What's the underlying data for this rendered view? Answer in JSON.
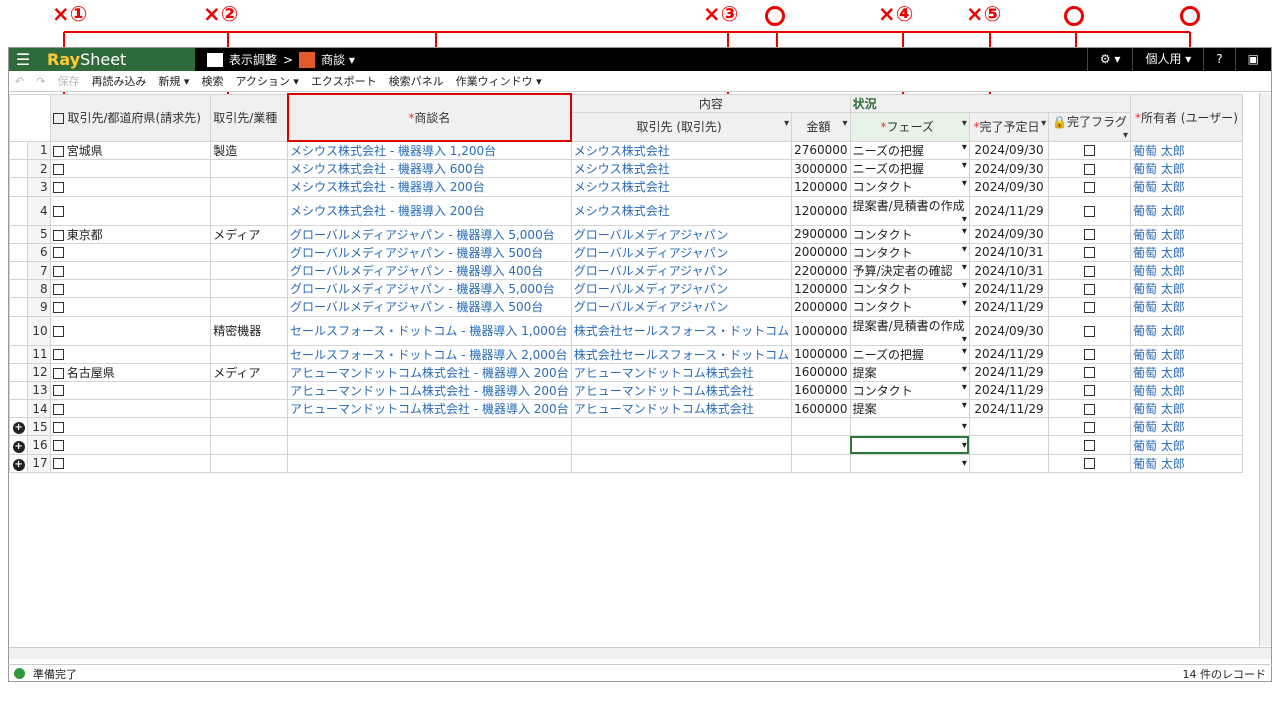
{
  "annotations": [
    "×①",
    "×②",
    "×③",
    "×④",
    "×⑤"
  ],
  "app": {
    "logo_a": "Ray",
    "logo_b": "Sheet",
    "breadcrumb_1": "表示調整",
    "breadcrumb_sep": ">",
    "breadcrumb_2": "商談 ▾",
    "settings": "⚙ ▾",
    "user": "個人用 ▾",
    "help": "?"
  },
  "toolbar": {
    "save": "保存",
    "reload": "再読み込み",
    "new": "新規 ▾",
    "search": "検索",
    "action": "アクション ▾",
    "export": "エクスポート",
    "search_panel": "検索パネル",
    "work_window": "作業ウィンドウ ▾"
  },
  "headers": {
    "pref": "取引先/都道府県(請求先)",
    "industry": "取引先/業種",
    "deal": "商談名",
    "group_content": "内容",
    "account": "取引先 (取引先)",
    "amount": "金額",
    "group_status": "状況",
    "phase": "フェーズ",
    "due": "完了予定日",
    "flag": "完了フラグ",
    "owner": "所有者 (ユーザー)",
    "req": "*"
  },
  "rows": [
    {
      "n": "1",
      "pref": "宮城県",
      "ind": "製造",
      "deal": "メシウス株式会社 - 機器導入 1,200台",
      "acc": "メシウス株式会社",
      "amt": "2760000",
      "ph": "ニーズの把握",
      "due": "2024/09/30",
      "own": "葡萄 太郎"
    },
    {
      "n": "2",
      "pref": "",
      "ind": "",
      "deal": "メシウス株式会社 - 機器導入 600台",
      "acc": "メシウス株式会社",
      "amt": "3000000",
      "ph": "ニーズの把握",
      "due": "2024/09/30",
      "own": "葡萄 太郎"
    },
    {
      "n": "3",
      "pref": "",
      "ind": "",
      "deal": "メシウス株式会社 - 機器導入 200台",
      "acc": "メシウス株式会社",
      "amt": "1200000",
      "ph": "コンタクト",
      "due": "2024/09/30",
      "own": "葡萄 太郎"
    },
    {
      "n": "4",
      "pref": "",
      "ind": "",
      "deal": "メシウス株式会社 - 機器導入 200台",
      "acc": "メシウス株式会社",
      "amt": "1200000",
      "ph": "提案書/見積書の作成",
      "due": "2024/11/29",
      "own": "葡萄 太郎"
    },
    {
      "n": "5",
      "pref": "東京都",
      "ind": "メディア",
      "deal": "グローバルメディアジャパン - 機器導入 5,000台",
      "acc": "グローバルメディアジャパン",
      "amt": "2900000",
      "ph": "コンタクト",
      "due": "2024/09/30",
      "own": "葡萄 太郎"
    },
    {
      "n": "6",
      "pref": "",
      "ind": "",
      "deal": "グローバルメディアジャパン - 機器導入 500台",
      "acc": "グローバルメディアジャパン",
      "amt": "2000000",
      "ph": "コンタクト",
      "due": "2024/10/31",
      "own": "葡萄 太郎"
    },
    {
      "n": "7",
      "pref": "",
      "ind": "",
      "deal": "グローバルメディアジャパン - 機器導入 400台",
      "acc": "グローバルメディアジャパン",
      "amt": "2200000",
      "ph": "予算/決定者の確認",
      "due": "2024/10/31",
      "own": "葡萄 太郎"
    },
    {
      "n": "8",
      "pref": "",
      "ind": "",
      "deal": "グローバルメディアジャパン - 機器導入 5,000台",
      "acc": "グローバルメディアジャパン",
      "amt": "1200000",
      "ph": "コンタクト",
      "due": "2024/11/29",
      "own": "葡萄 太郎"
    },
    {
      "n": "9",
      "pref": "",
      "ind": "",
      "deal": "グローバルメディアジャパン - 機器導入 500台",
      "acc": "グローバルメディアジャパン",
      "amt": "2000000",
      "ph": "コンタクト",
      "due": "2024/11/29",
      "own": "葡萄 太郎"
    },
    {
      "n": "10",
      "pref": "",
      "ind": "精密機器",
      "deal": "セールスフォース・ドットコム - 機器導入 1,000台",
      "acc": "株式会社セールスフォース・ドットコム",
      "amt": "1000000",
      "ph": "提案書/見積書の作成",
      "due": "2024/09/30",
      "own": "葡萄 太郎"
    },
    {
      "n": "11",
      "pref": "",
      "ind": "",
      "deal": "セールスフォース・ドットコム - 機器導入 2,000台",
      "acc": "株式会社セールスフォース・ドットコム",
      "amt": "1000000",
      "ph": "ニーズの把握",
      "due": "2024/11/29",
      "own": "葡萄 太郎"
    },
    {
      "n": "12",
      "pref": "名古屋県",
      "ind": "メディア",
      "deal": "アヒューマンドットコム株式会社 - 機器導入 200台",
      "acc": "アヒューマンドットコム株式会社",
      "amt": "1600000",
      "ph": "提案",
      "due": "2024/11/29",
      "own": "葡萄 太郎"
    },
    {
      "n": "13",
      "pref": "",
      "ind": "",
      "deal": "アヒューマンドットコム株式会社 - 機器導入 200台",
      "acc": "アヒューマンドットコム株式会社",
      "amt": "1600000",
      "ph": "コンタクト",
      "due": "2024/11/29",
      "own": "葡萄 太郎"
    },
    {
      "n": "14",
      "pref": "",
      "ind": "",
      "deal": "アヒューマンドットコム株式会社 - 機器導入 200台",
      "acc": "アヒューマンドットコム株式会社",
      "amt": "1600000",
      "ph": "提案",
      "due": "2024/11/29",
      "own": "葡萄 太郎"
    },
    {
      "n": "15",
      "pref": "",
      "ind": "",
      "deal": "",
      "acc": "",
      "amt": "",
      "ph": "",
      "due": "",
      "own": "葡萄 太郎"
    },
    {
      "n": "16",
      "pref": "",
      "ind": "",
      "deal": "",
      "acc": "",
      "amt": "",
      "ph": "",
      "due": "",
      "own": "葡萄 太郎"
    },
    {
      "n": "17",
      "pref": "",
      "ind": "",
      "deal": "",
      "acc": "",
      "amt": "",
      "ph": "",
      "due": "",
      "own": "葡萄 太郎"
    }
  ],
  "status": {
    "ready": "準備完了",
    "count": "14 件のレコード"
  }
}
